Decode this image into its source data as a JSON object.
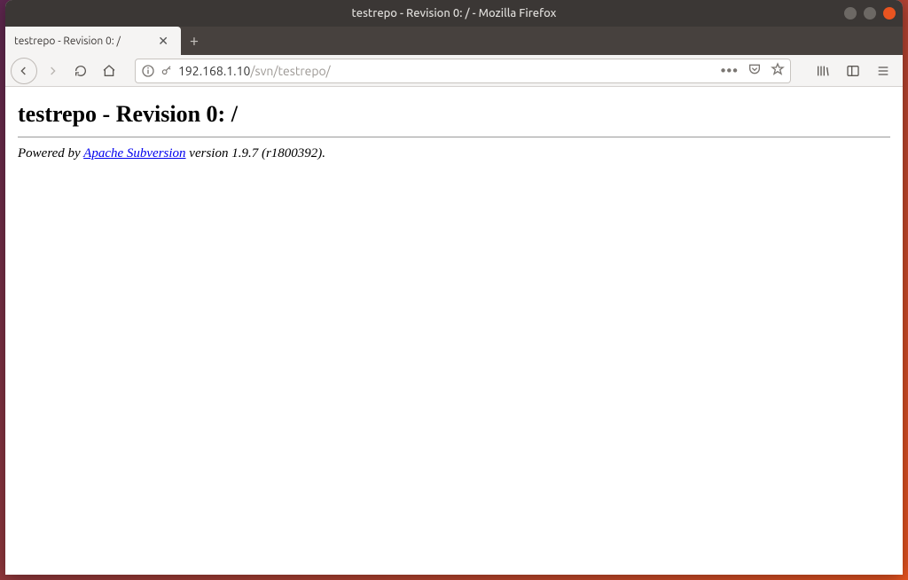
{
  "window": {
    "title": "testrepo - Revision 0: / - Mozilla Firefox"
  },
  "tabs": [
    {
      "label": "testrepo - Revision 0: /"
    }
  ],
  "url": {
    "host": "192.168.1.10",
    "path": "/svn/testrepo/"
  },
  "page": {
    "heading": "testrepo - Revision 0: /",
    "powered_prefix": "Powered by ",
    "powered_link_text": "Apache Subversion",
    "powered_suffix": " version 1.9.7 (r1800392)."
  }
}
